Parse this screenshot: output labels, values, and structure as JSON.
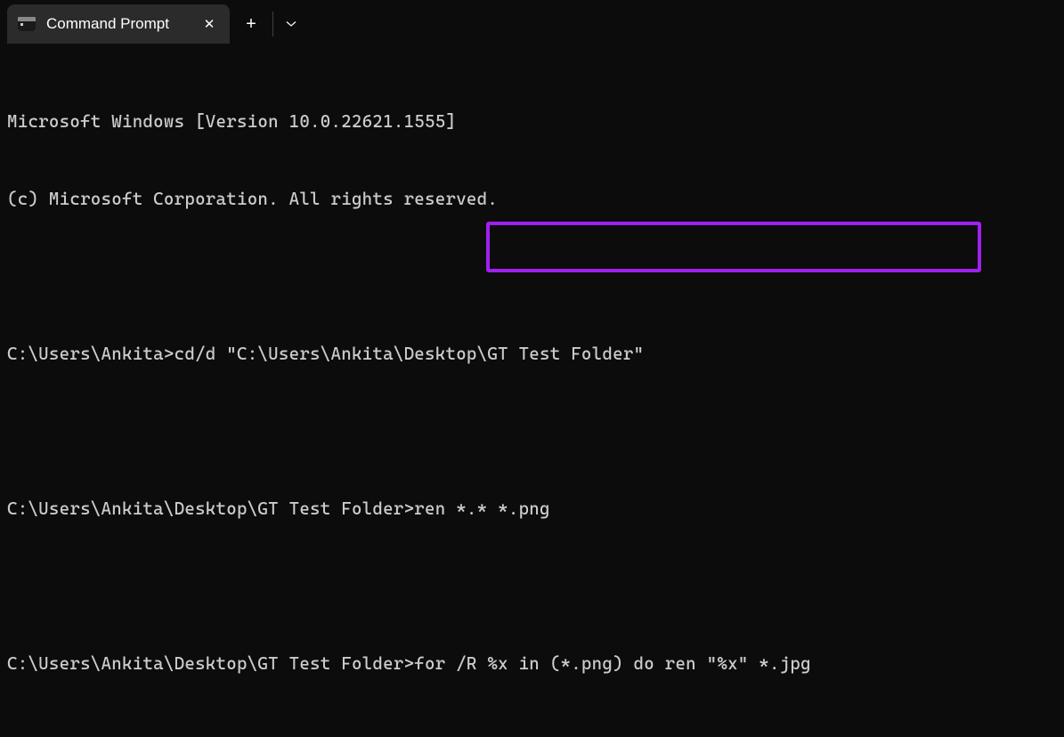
{
  "titleBar": {
    "tabTitle": "Command Prompt",
    "closeLabel": "✕",
    "newTabLabel": "+",
    "dropdownLabel": "⌄"
  },
  "terminal": {
    "lines": [
      "Microsoft Windows [Version 10.0.22621.1555]",
      "(c) Microsoft Corporation. All rights reserved.",
      "",
      "C:\\Users\\Ankita>cd/d \"C:\\Users\\Ankita\\Desktop\\GT Test Folder\"",
      "",
      "C:\\Users\\Ankita\\Desktop\\GT Test Folder>ren *.* *.png",
      "",
      "C:\\Users\\Ankita\\Desktop\\GT Test Folder>for /R %x in (*.png) do ren \"%x\" *.jpg"
    ]
  },
  "highlight": {
    "color": "#a020f0"
  }
}
